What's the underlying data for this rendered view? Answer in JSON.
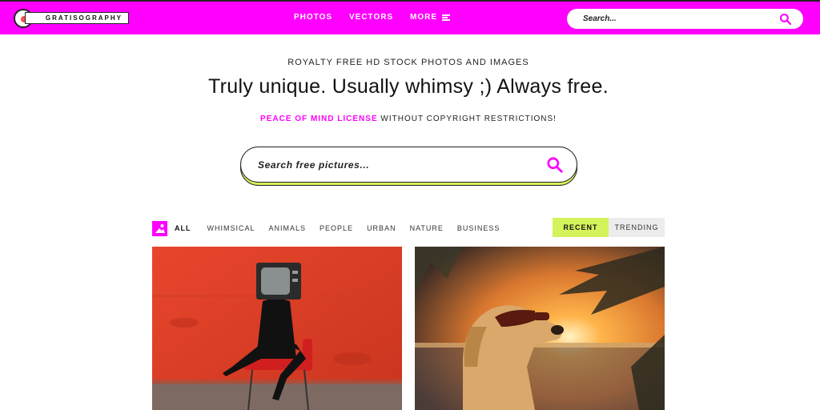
{
  "header": {
    "logo_text": "GRATISOGRAPHY",
    "nav": {
      "photos": "PHOTOS",
      "vectors": "VECTORS",
      "more": "MORE"
    },
    "search_placeholder": "Search..."
  },
  "hero": {
    "kicker": "ROYALTY FREE HD STOCK PHOTOS AND IMAGES",
    "headline": "Truly unique. Usually whimsy ;) Always free.",
    "license_link": "PEACE OF MIND LICENSE",
    "license_rest": " WITHOUT COPYRIGHT RESTRICTIONS!",
    "search_placeholder": "Search free pictures..."
  },
  "filters": {
    "categories": [
      "ALL",
      "WHIMSICAL",
      "ANIMALS",
      "PEOPLE",
      "URBAN",
      "NATURE",
      "BUSINESS"
    ],
    "active_category": "ALL",
    "sort": {
      "recent": "RECENT",
      "trending": "TRENDING",
      "active": "RECENT"
    }
  },
  "colors": {
    "brand": "#ff00ff",
    "accent_lime": "#d4f25a"
  },
  "icons": {
    "search": "search-icon",
    "menu": "hamburger-icon",
    "filter": "image-filter-icon"
  }
}
